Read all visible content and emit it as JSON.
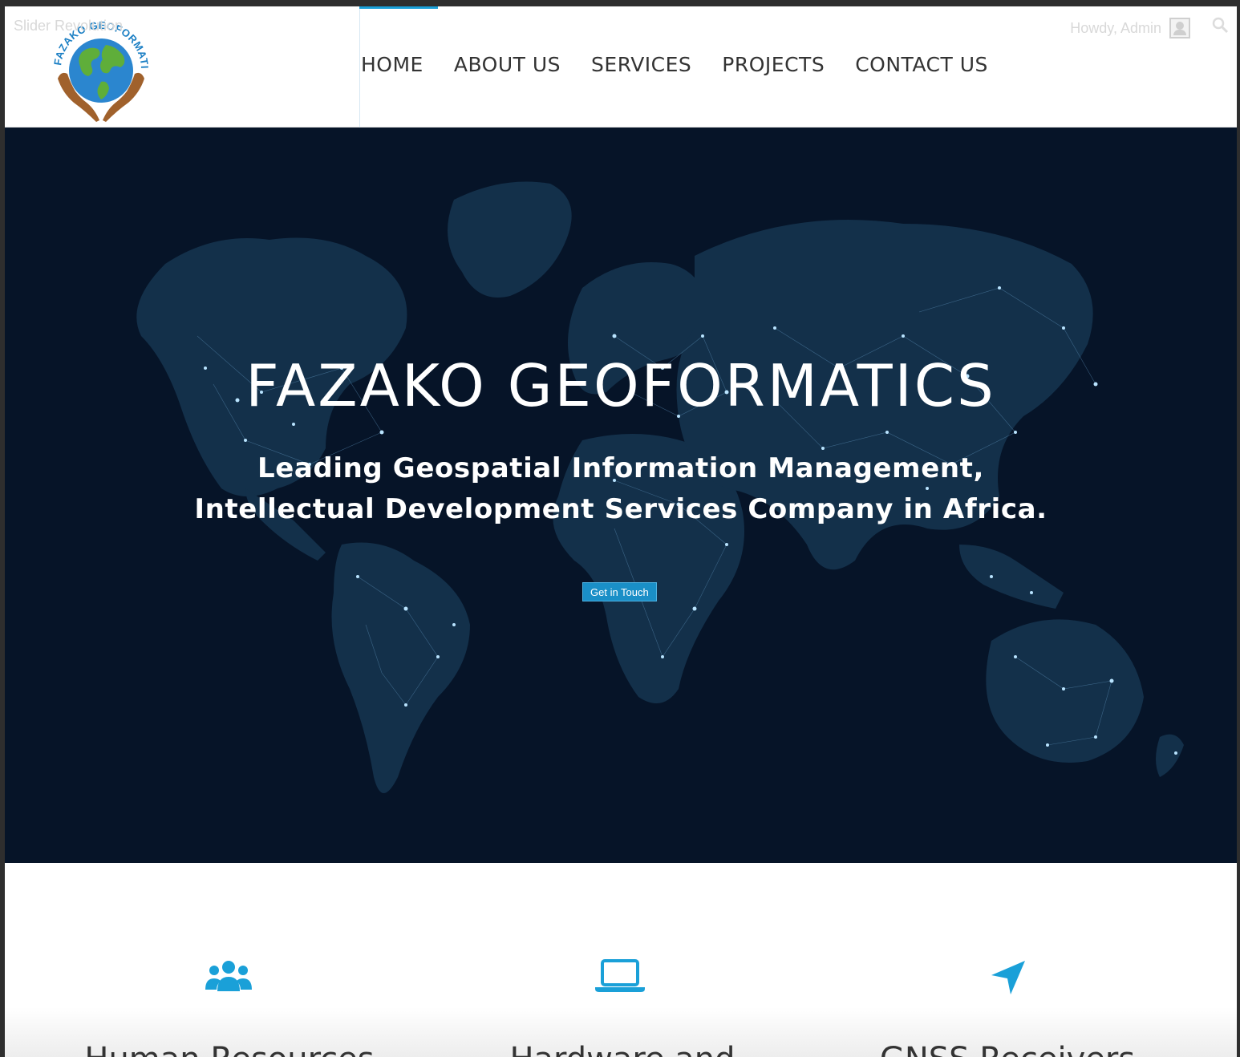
{
  "adminbar": {
    "left_label": "Slider Revolution",
    "greeting": "Howdy, Admin"
  },
  "logo": {
    "arc_text": "FAZAKO GEOFORMATICS"
  },
  "nav": {
    "items": [
      "HOME",
      "ABOUT US",
      "SERVICES",
      "PROJECTS",
      "CONTACT US"
    ],
    "active": "HOME"
  },
  "hero": {
    "title": "FAZAKO GEOFORMATICS",
    "subtitle_line1": "Leading Geospatial Information Management,",
    "subtitle_line2": "Intellectual Development Services Company in Africa.",
    "button_label": "Get in Touch"
  },
  "features": [
    {
      "icon": "users-icon",
      "title": "Human Resources"
    },
    {
      "icon": "laptop-icon",
      "title": "Hardware and"
    },
    {
      "icon": "location-arrow-icon",
      "title": "GNSS Receivers"
    }
  ],
  "colors": {
    "accent": "#1aa0d8",
    "hero_bg": "#061428",
    "map_land": "#15314a",
    "button": "#1a8fc7"
  }
}
